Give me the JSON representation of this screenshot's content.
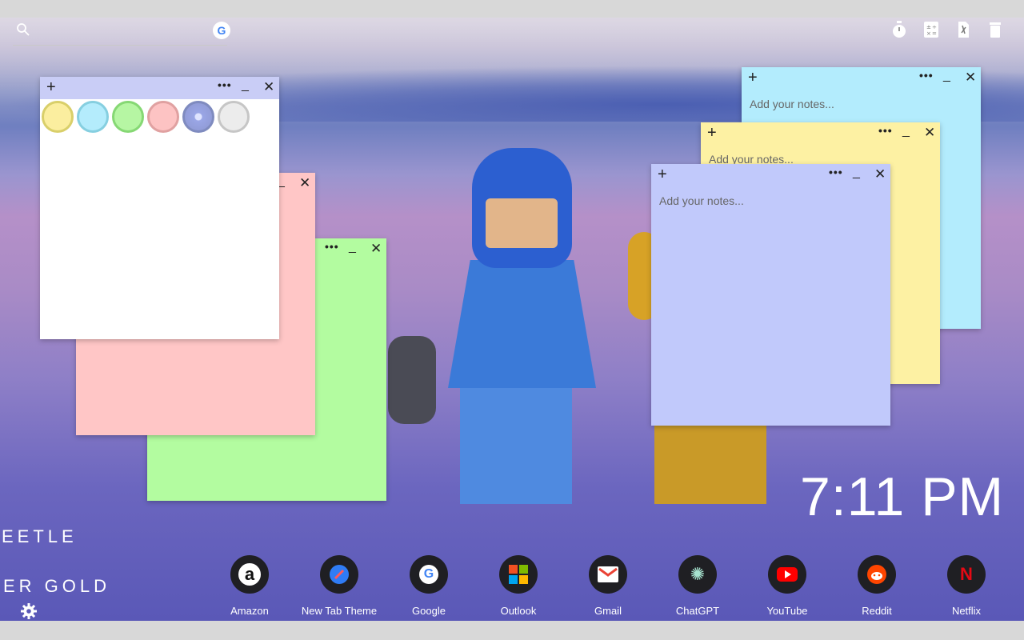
{
  "search": {
    "icon": "search-icon",
    "engine_icon": "google-icon",
    "engine_letter": "G"
  },
  "toolbar_icons": [
    "stopwatch-icon",
    "calculator-icon",
    "tools-icon",
    "trash-icon"
  ],
  "notes": [
    {
      "color": "#ffffff",
      "bar_color": "#c9cdf6",
      "placeholder": ""
    },
    {
      "color": "#ffc6c6",
      "bar_color": "#ffc6c6",
      "placeholder": ""
    },
    {
      "color": "#b3fca0",
      "bar_color": "#b3fca0",
      "placeholder": ""
    },
    {
      "color": "#b3ecfd",
      "bar_color": "#b3ecfd",
      "placeholder": "Add your notes..."
    },
    {
      "color": "#fdf1a3",
      "bar_color": "#fdf1a3",
      "placeholder": "Add your notes..."
    },
    {
      "color": "#c1c9fb",
      "bar_color": "#c1c9fb",
      "placeholder": "Add your notes..."
    }
  ],
  "note_controls": {
    "add": "+",
    "more": "•••",
    "minimize": "_",
    "close": "✕"
  },
  "palette": [
    {
      "fill": "#fbee9f",
      "border": "#d9cf6a"
    },
    {
      "fill": "#b4ecfc",
      "border": "#86cfe0"
    },
    {
      "fill": "#b6f6a3",
      "border": "#86d874"
    },
    {
      "fill": "#fdc3c3",
      "border": "#e0a1a1"
    },
    {
      "fill": "#b8c1f9",
      "border": "#7f8bbf"
    },
    {
      "fill": "#ececec",
      "border": "#c6c6c6"
    }
  ],
  "clock": "7:11 PM",
  "side_text": {
    "line1": "EETLE",
    "line2": "ER GOLD"
  },
  "settings_icon": "gear-icon",
  "dock": [
    {
      "label": "Amazon",
      "icon": "amazon-icon",
      "glyph": "a",
      "color": "#ffffff"
    },
    {
      "label": "New Tab Theme",
      "icon": "new-tab-theme-icon",
      "glyph": "✎",
      "color": "#ffffff"
    },
    {
      "label": "Google",
      "icon": "google-icon",
      "glyph": "G",
      "color": "#4285f4"
    },
    {
      "label": "Outlook",
      "icon": "outlook-icon",
      "glyph": "",
      "color": "#ffffff"
    },
    {
      "label": "Gmail",
      "icon": "gmail-icon",
      "glyph": "M",
      "color": "#ea4335"
    },
    {
      "label": "ChatGPT",
      "icon": "chatgpt-icon",
      "glyph": "✺",
      "color": "#a6e3cf"
    },
    {
      "label": "YouTube",
      "icon": "youtube-icon",
      "glyph": "▶",
      "color": "#ffffff"
    },
    {
      "label": "Reddit",
      "icon": "reddit-icon",
      "glyph": "●",
      "color": "#ffffff"
    },
    {
      "label": "Netflix",
      "icon": "netflix-icon",
      "glyph": "N",
      "color": "#e50914"
    }
  ]
}
